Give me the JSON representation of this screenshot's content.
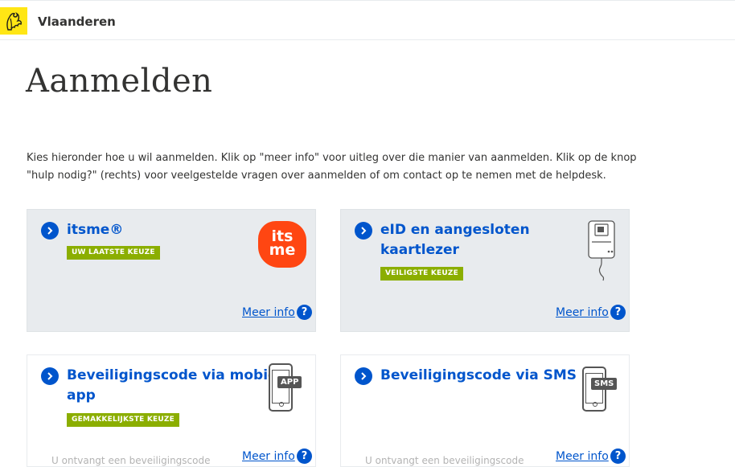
{
  "header": {
    "brand": "Vlaanderen"
  },
  "page": {
    "title": "Aanmelden",
    "intro": "Kies hieronder hoe u wil aanmelden. Klik op \"meer info\" voor uitleg over die manier van aanmelden. Klik op de knop \"hulp nodig?\" (rechts) voor veelgestelde vragen over aanmelden of om contact op te nemen met de helpdesk."
  },
  "options": [
    {
      "title": "itsme®",
      "badge": "UW LAATSTE KEUZE",
      "meer": "Meer info",
      "logo_text_1": "its",
      "logo_text_2": "me"
    },
    {
      "title_line1": "eID en aangesloten",
      "title_line2": "kaartlezer",
      "badge": "VEILIGSTE KEUZE",
      "meer": "Meer info"
    },
    {
      "title_line1": "Beveiligingscode via mobiele",
      "title_line2": "app",
      "badge": "GEMAKKELIJKSTE KEUZE",
      "meer": "Meer info",
      "icon_text": "APP",
      "footer": "U ontvangt een beveiligingscode"
    },
    {
      "title": "Beveiligingscode via SMS",
      "meer": "Meer info",
      "icon_text": "SMS",
      "footer": "U ontvangt een beveiligingscode"
    }
  ],
  "colors": {
    "link": "#0055cc",
    "badge": "#8bae00",
    "logo_yellow": "#ffe615",
    "itsme": "#ff4612",
    "card_grey": "#e8ebee"
  },
  "icons": [
    "flemish-lion-icon",
    "chevron-right-icon",
    "question-icon",
    "itsme-logo",
    "card-reader-icon",
    "phone-app-icon",
    "phone-sms-icon"
  ]
}
